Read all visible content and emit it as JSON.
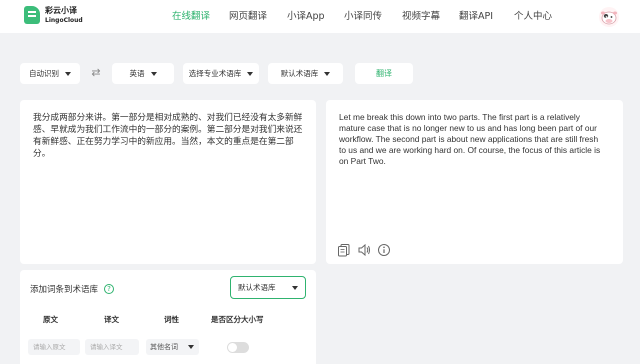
{
  "header": {
    "logo_cn": "彩云小译",
    "logo_en": "LingoCloud",
    "nav": [
      {
        "label": "在线翻译",
        "active": true
      },
      {
        "label": "网页翻译",
        "active": false
      },
      {
        "label": "小译App",
        "active": false
      },
      {
        "label": "小译同传",
        "active": false
      },
      {
        "label": "视频字幕",
        "active": false
      },
      {
        "label": "翻译API",
        "active": false
      },
      {
        "label": "个人中心",
        "active": false
      }
    ]
  },
  "toolbar": {
    "source_lang": "自动识别",
    "swap_icon": "swap-arrows-icon",
    "target_lang": "英语",
    "domain_select": "选择专业术语库",
    "term_select": "默认术语库",
    "translate_label": "翻译"
  },
  "source": {
    "text": "我分成两部分来讲。第一部分是相对成熟的、对我们已经没有太多新鲜感、早就成为我们工作流中的一部分的案例。第二部分是对我们来说还有新鲜感、正在努力学习中的新应用。当然，本文的重点是在第二部分。"
  },
  "target": {
    "text": "Let me break this down into two parts. The first part is a relatively mature case that is no longer new to us and has long been part of our workflow. The second part is about new applications that are still fresh to us and we are working hard on. Of course, the focus of this article is on Part Two.",
    "tools": [
      "copy-icon",
      "speaker-icon",
      "info-icon"
    ]
  },
  "glossary": {
    "title": "添加词条到术语库",
    "help_icon": "question-icon",
    "library": "默认术语库",
    "columns": [
      "原文",
      "译文",
      "词性",
      "是否区分大小写"
    ],
    "source_placeholder": "请输入原文",
    "target_placeholder": "请输入译文",
    "pos_value": "其他名词",
    "case_sensitive": false
  },
  "colors": {
    "accent": "#2fb36f",
    "background": "#f1f2f4"
  }
}
